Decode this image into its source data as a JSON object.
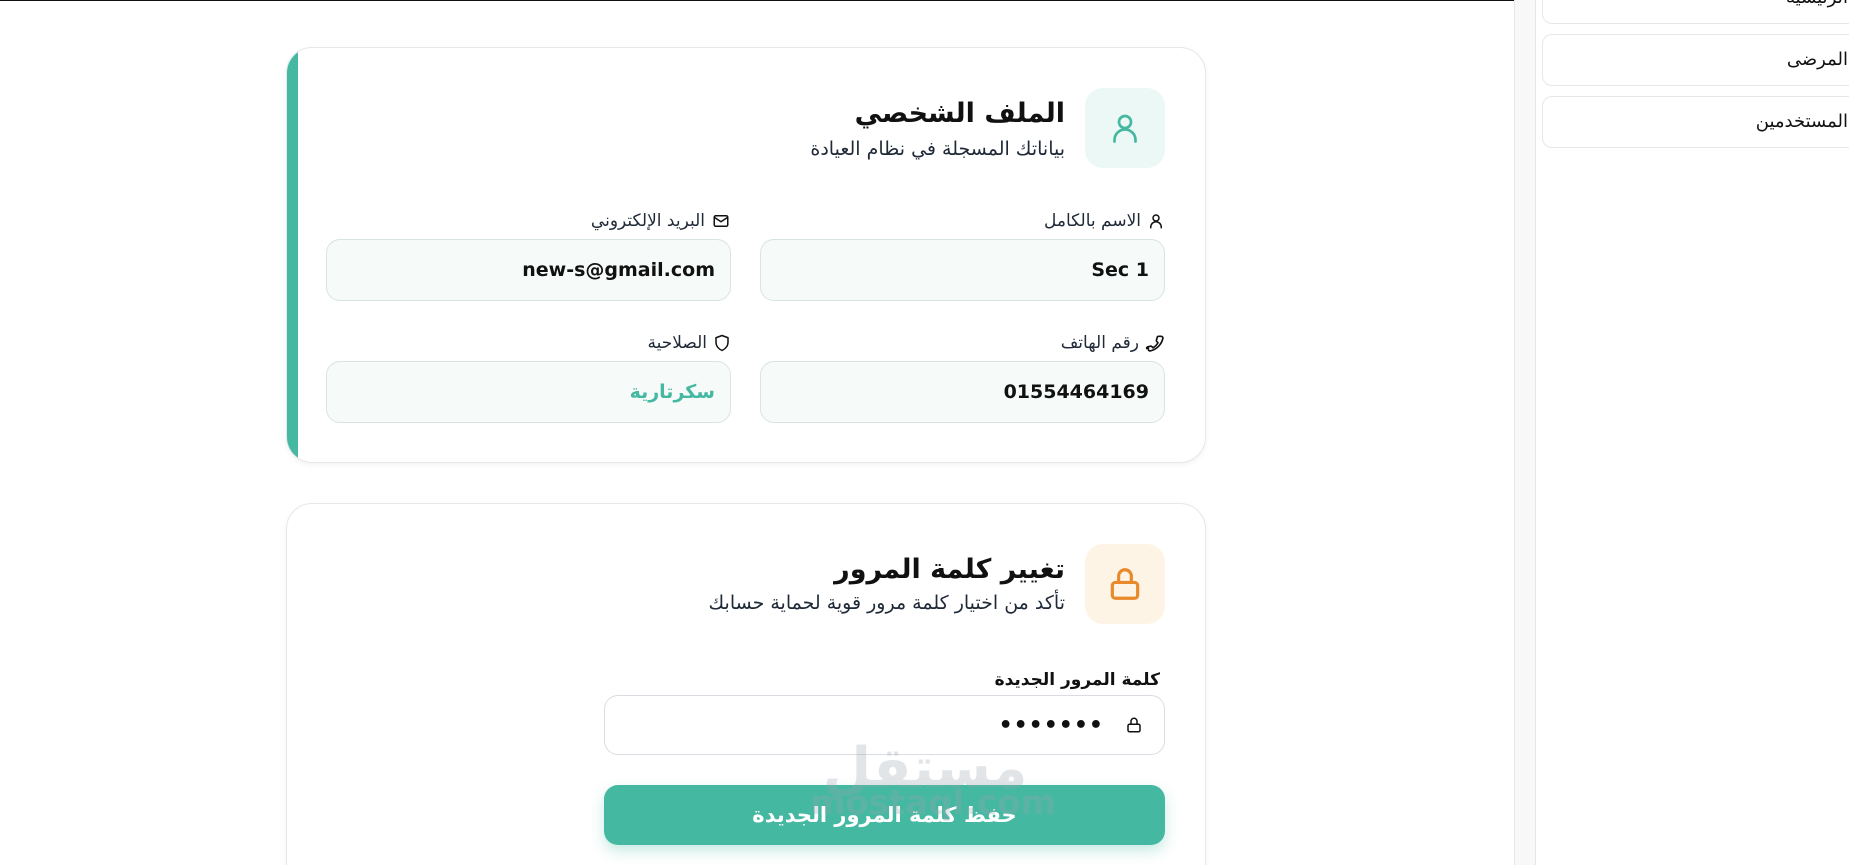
{
  "sidebar": {
    "items": [
      {
        "label": "الرئيسية"
      },
      {
        "label": "المرضى"
      },
      {
        "label": "المستخدمين"
      }
    ]
  },
  "profile": {
    "title": "الملف الشخصي",
    "subtitle": "بياناتك المسجلة في نظام العيادة",
    "fields": {
      "name": {
        "label": "الاسم بالكامل",
        "value": "Sec 1",
        "icon": "user-icon"
      },
      "email": {
        "label": "البريد الإلكتروني",
        "value": "new-s@gmail.com",
        "icon": "mail-icon"
      },
      "phone": {
        "label": "رقم الهاتف",
        "value": "01554464169",
        "icon": "phone-icon"
      },
      "role": {
        "label": "الصلاحية",
        "value": "سكرتارية",
        "icon": "shield-icon"
      }
    }
  },
  "password": {
    "title": "تغيير كلمة المرور",
    "subtitle": "تأكد من اختيار كلمة مرور قوية لحماية حسابك",
    "new_label": "كلمة المرور الجديدة",
    "new_value": "•••••••",
    "save_label": "حفظ كلمة المرور الجديدة"
  },
  "watermark": {
    "arabic": "مستقل",
    "latin": "mostaql.com"
  },
  "colors": {
    "accent": "#45b8a1",
    "orange": "#e8892a",
    "teal_bg": "#ecf8f5",
    "orange_bg": "#fef4e6"
  }
}
